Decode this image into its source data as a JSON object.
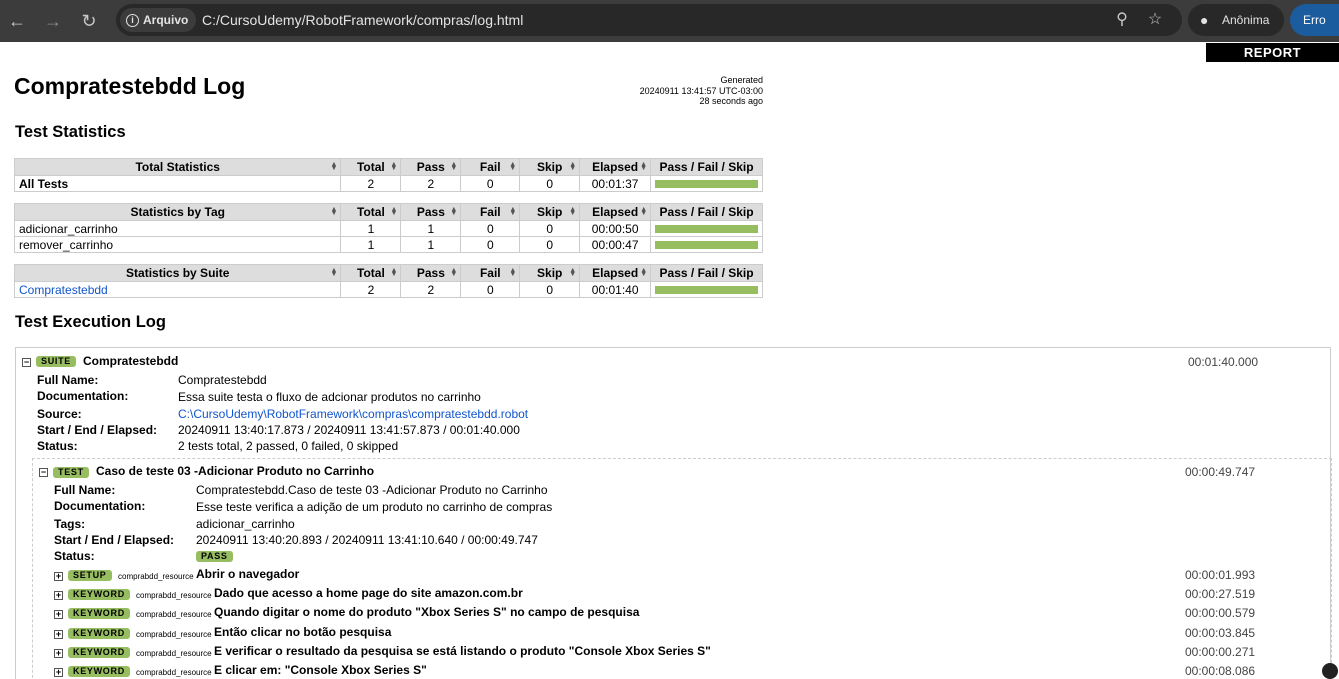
{
  "browser": {
    "security_label": "Arquivo",
    "url": "C:/CursoUdemy/RobotFramework/compras/log.html",
    "profile_label": "Anônima",
    "error_label": "Erro"
  },
  "report_button": "REPORT",
  "title": "Compratestebdd Log",
  "generated": {
    "label": "Generated",
    "timestamp": "20240911 13:41:57 UTC-03:00",
    "ago": "28 seconds ago"
  },
  "test_statistics_heading": "Test Statistics",
  "columns": [
    "Total",
    "Pass",
    "Fail",
    "Skip",
    "Elapsed",
    "Pass / Fail / Skip"
  ],
  "total_statistics": {
    "header": "Total Statistics",
    "rows": [
      {
        "name": "All Tests",
        "total": "2",
        "pass": "2",
        "fail": "0",
        "skip": "0",
        "elapsed": "00:01:37",
        "pass_fraction": 1.0
      }
    ]
  },
  "tag_statistics": {
    "header": "Statistics by Tag",
    "rows": [
      {
        "name": "adicionar_carrinho",
        "total": "1",
        "pass": "1",
        "fail": "0",
        "skip": "0",
        "elapsed": "00:00:50",
        "pass_fraction": 1.0
      },
      {
        "name": "remover_carrinho",
        "total": "1",
        "pass": "1",
        "fail": "0",
        "skip": "0",
        "elapsed": "00:00:47",
        "pass_fraction": 1.0
      }
    ]
  },
  "suite_statistics": {
    "header": "Statistics by Suite",
    "rows": [
      {
        "name": "Compratestebdd",
        "total": "2",
        "pass": "2",
        "fail": "0",
        "skip": "0",
        "elapsed": "00:01:40",
        "pass_fraction": 1.0
      }
    ]
  },
  "execution_log_heading": "Test Execution Log",
  "suite": {
    "label": "SUITE",
    "name": "Compratestebdd",
    "elapsed": "00:01:40.000",
    "fields": {
      "full_name_label": "Full Name:",
      "full_name": "Compratestebdd",
      "doc_label": "Documentation:",
      "doc": "Essa suite testa o fluxo de adcionar produtos no carrinho",
      "source_label": "Source:",
      "source": "C:\\CursoUdemy\\RobotFramework\\compras\\compratestebdd.robot",
      "times_label": "Start / End / Elapsed:",
      "times": "20240911 13:40:17.873 / 20240911 13:41:57.873 / 00:01:40.000",
      "status_label": "Status:",
      "status": "2 tests total, 2 passed, 0 failed, 0 skipped"
    }
  },
  "test": {
    "label": "TEST",
    "name": "Caso de teste 03 -Adicionar Produto no Carrinho",
    "elapsed": "00:00:49.747",
    "fields": {
      "full_name_label": "Full Name:",
      "full_name": "Compratestebdd.Caso de teste 03 -Adicionar Produto no Carrinho",
      "doc_label": "Documentation:",
      "doc": "Esse teste verifica a adição de um produto no carrinho de compras",
      "tags_label": "Tags:",
      "tags": "adicionar_carrinho",
      "times_label": "Start / End / Elapsed:",
      "times": "20240911 13:40:20.893 / 20240911 13:41:10.640 / 00:00:49.747",
      "status_label": "Status:",
      "status": "PASS"
    }
  },
  "keywords": [
    {
      "label": "SETUP",
      "lib": "comprabdd_resource",
      "name": "Abrir o navegador",
      "elapsed": "00:00:01.993"
    },
    {
      "label": "KEYWORD",
      "lib": "comprabdd_resource",
      "name": "Dado que acesso a home page do site amazon.com.br",
      "elapsed": "00:00:27.519"
    },
    {
      "label": "KEYWORD",
      "lib": "comprabdd_resource",
      "name": "Quando digitar o nome do produto \"Xbox Series S\" no campo de pesquisa",
      "elapsed": "00:00:00.579"
    },
    {
      "label": "KEYWORD",
      "lib": "comprabdd_resource",
      "name": "Então clicar no botão pesquisa",
      "elapsed": "00:00:03.845"
    },
    {
      "label": "KEYWORD",
      "lib": "comprabdd_resource",
      "name": "E verificar o resultado da pesquisa se está listando o produto \"Console Xbox Series S\"",
      "elapsed": "00:00:00.271"
    },
    {
      "label": "KEYWORD",
      "lib": "comprabdd_resource",
      "name": "E clicar em: \"Console Xbox Series S\"",
      "elapsed": "00:00:08.086"
    }
  ],
  "colors": {
    "pass_green": "#97bd61",
    "link_blue": "#1155cc",
    "chrome_bg": "#3c3c3c"
  }
}
